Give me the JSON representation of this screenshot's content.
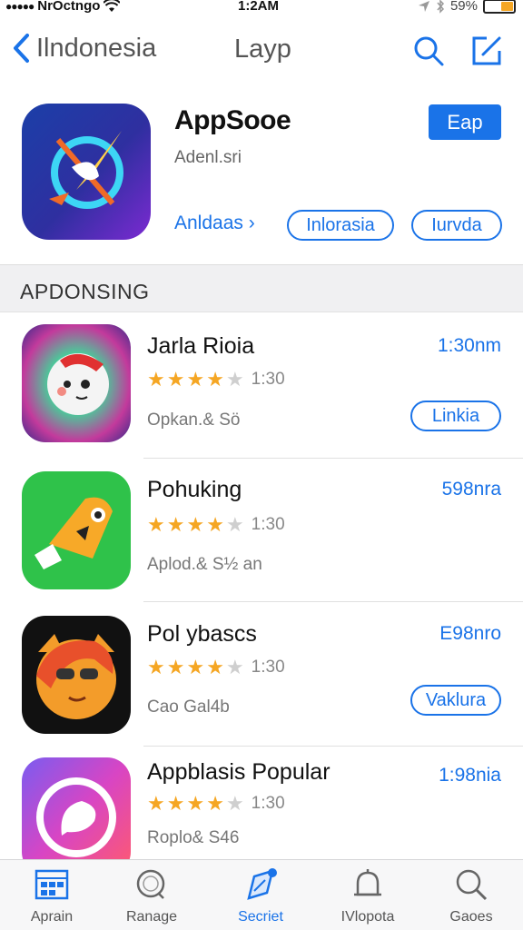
{
  "status_bar": {
    "carrier": "NrOctngo",
    "time": "1:2AM",
    "battery": "59%"
  },
  "nav": {
    "back_label": "Ilndonesia",
    "title": "Layp"
  },
  "header": {
    "title": "AppSooe",
    "subtitle": "Adenl.sri",
    "get_label": "Eap",
    "link_label": "Anldaas ›",
    "pill_1": "Inlorasia",
    "pill_2": "Iurvda"
  },
  "section": {
    "title": "APDONSING"
  },
  "apps": [
    {
      "name": "Jarla Rioia",
      "rating": 3.5,
      "rating_count": "1:30",
      "meta": "Opkan.& Sö",
      "price": "1:30nm",
      "action": "Linkia"
    },
    {
      "name": "Pohuking",
      "rating": 3.5,
      "rating_count": "1:30",
      "meta": "Aplod.& S½ an",
      "price": "598nra",
      "action": ""
    },
    {
      "name": "Pol ybascs",
      "rating": 3.5,
      "rating_count": "1:30",
      "meta": "Cao Gal4b",
      "price": "E98nro",
      "action": "Vaklura"
    },
    {
      "name": "Appblasis Popular",
      "rating": 3.5,
      "rating_count": "1:30",
      "meta": "Roplo& S46",
      "price": "1:98nia",
      "action": ""
    }
  ],
  "tabs": [
    {
      "label": "Aprain",
      "icon": "grid-icon"
    },
    {
      "label": "Ranage",
      "icon": "search-icon"
    },
    {
      "label": "Secriet",
      "icon": "explore-icon",
      "active": true
    },
    {
      "label": "IVlopota",
      "icon": "bell-icon"
    },
    {
      "label": "Gaoes",
      "icon": "search-icon"
    }
  ],
  "colors": {
    "accent": "#1a73e8",
    "star": "#f5a623",
    "section_bg": "#f0f0f2"
  }
}
